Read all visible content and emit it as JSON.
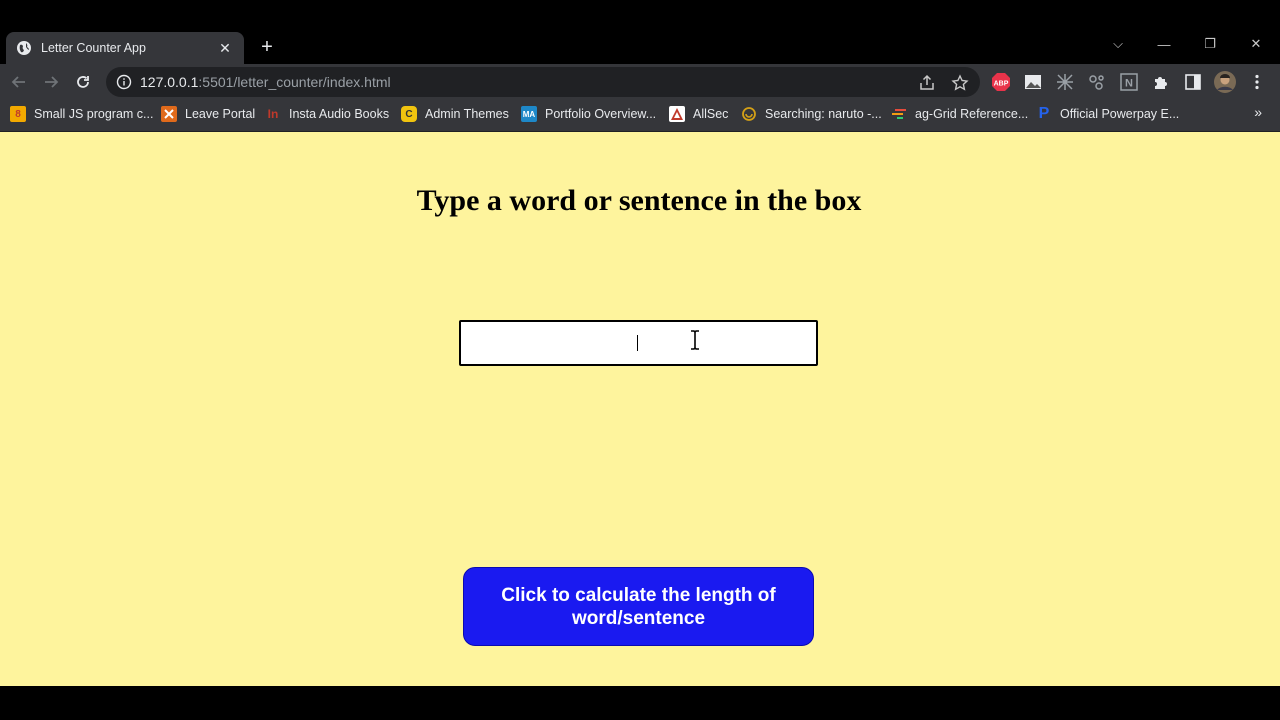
{
  "browser": {
    "tab": {
      "title": "Letter Counter App",
      "close_glyph": "✕"
    },
    "new_tab_glyph": "+",
    "window_controls": {
      "tab_search_glyph": "⌵",
      "minimize_glyph": "—",
      "restore_glyph": "❐",
      "close_glyph": "✕"
    },
    "address": {
      "host": "127.0.0.1",
      "rest": ":5501/letter_counter/index.html"
    },
    "bookmarks": [
      {
        "label": "Small JS program c...",
        "icon": "8",
        "color": "#f2a900"
      },
      {
        "label": "Leave Portal",
        "icon": "",
        "color": "#e06a1b"
      },
      {
        "label": "Insta Audio Books",
        "icon": "In",
        "color": "#c0392b"
      },
      {
        "label": "Admin Themes",
        "icon": "C",
        "color": "#f1c40f"
      },
      {
        "label": "Portfolio Overview...",
        "icon": "MA",
        "color": "#1e88c8"
      },
      {
        "label": "AllSec",
        "icon": "",
        "color": "#ffffff"
      },
      {
        "label": "Searching: naruto -...",
        "icon": "",
        "color": "#d4a017"
      },
      {
        "label": "ag-Grid Reference...",
        "icon": "",
        "color": "#e74c3c"
      },
      {
        "label": "Official Powerpay E...",
        "icon": "P",
        "color": "#2563eb"
      }
    ],
    "bookmarks_more_glyph": "»",
    "extensions": [
      {
        "name": "adblock-plus-icon",
        "label": "ABP",
        "color": "#e8334a"
      },
      {
        "name": "extension-image-icon",
        "label": "",
        "color": "#cccccc"
      },
      {
        "name": "extension-grid-icon",
        "label": "",
        "color": "#9aa0a6"
      },
      {
        "name": "extension-molecule-icon",
        "label": "",
        "color": "#9aa0a6"
      },
      {
        "name": "extension-n-icon",
        "label": "N",
        "color": "#9aa0a6"
      }
    ]
  },
  "page": {
    "heading": "Type a word or sentence in the box",
    "input": {
      "value": "",
      "placeholder": ""
    },
    "button_label": "Click to calculate the length of word/sentence",
    "background": "#fef49d",
    "button_color": "#1a1af0"
  }
}
